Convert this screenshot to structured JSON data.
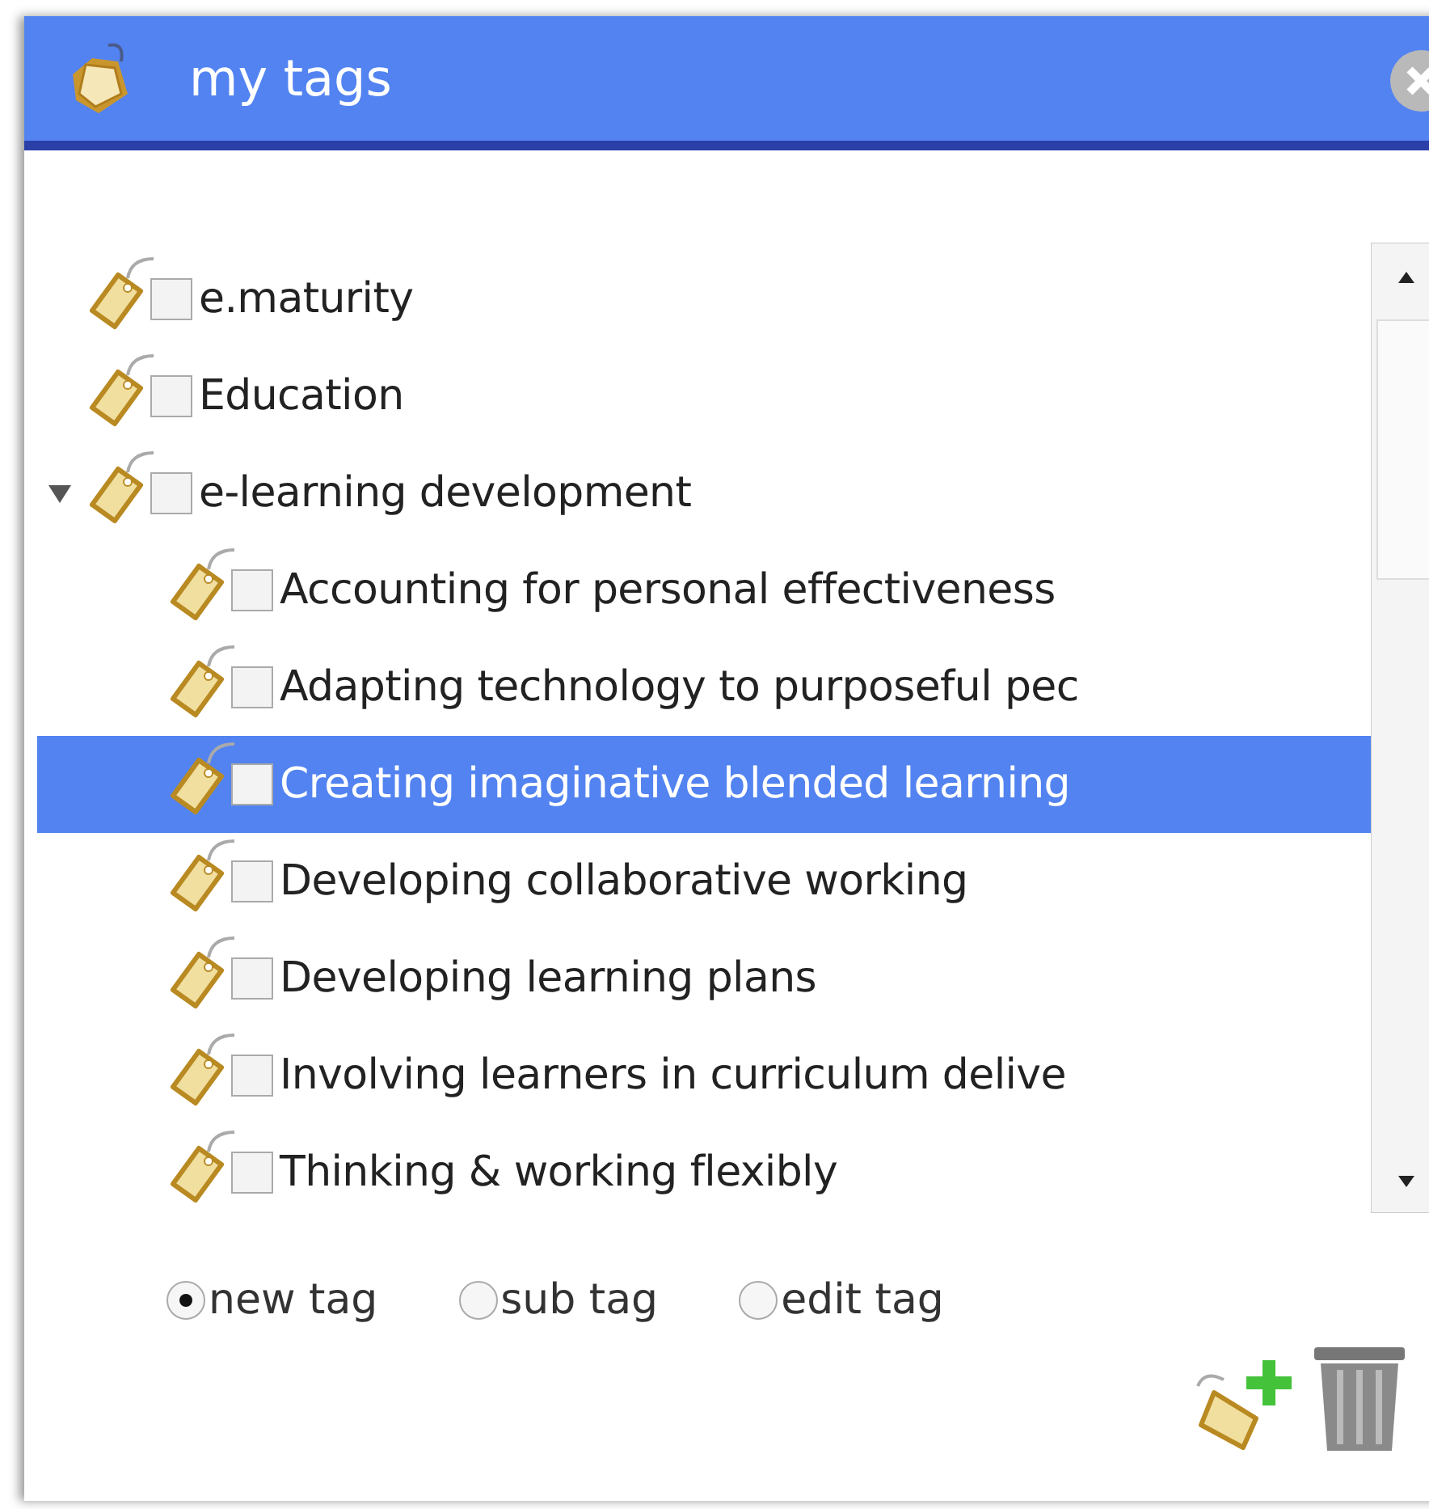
{
  "window": {
    "title": "my tags"
  },
  "tags": [
    {
      "label": "e.maturity",
      "checked": false,
      "selected": false
    },
    {
      "label": "Education",
      "checked": false,
      "selected": false
    },
    {
      "label": "e-learning development",
      "checked": false,
      "selected": false,
      "expanded": true,
      "children": [
        {
          "label": "Accounting for personal effectiveness",
          "checked": false,
          "selected": false
        },
        {
          "label": "Adapting technology to purposeful pec",
          "checked": false,
          "selected": false
        },
        {
          "label": "Creating imaginative blended learning",
          "checked": false,
          "selected": true
        },
        {
          "label": "Developing collaborative working",
          "checked": false,
          "selected": false
        },
        {
          "label": "Developing learning plans",
          "checked": false,
          "selected": false
        },
        {
          "label": "Involving learners in curriculum delive",
          "checked": false,
          "selected": false
        },
        {
          "label": "Thinking & working flexibly",
          "checked": false,
          "selected": false
        }
      ]
    }
  ],
  "options": [
    {
      "label": "new tag",
      "selected": true
    },
    {
      "label": "sub tag",
      "selected": false
    },
    {
      "label": "edit tag",
      "selected": false
    }
  ]
}
